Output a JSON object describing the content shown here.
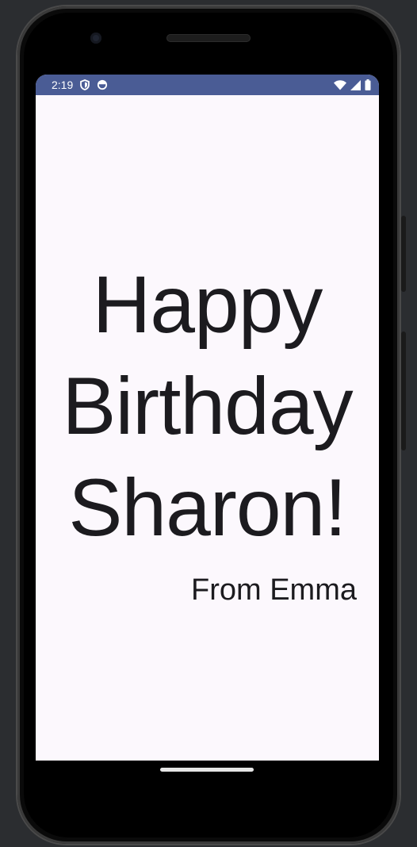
{
  "status_bar": {
    "time": "2:19",
    "left_icons": [
      "shield-icon",
      "data-saver-icon"
    ],
    "right_icons": [
      "wifi-icon",
      "cell-signal-icon",
      "battery-icon"
    ],
    "color": "#4a5c95"
  },
  "card": {
    "message": "Happy Birthday Sharon!",
    "signature": "From Emma",
    "background": "#fcf8fd",
    "text_color": "#1c1b1f"
  },
  "navigation": {
    "handle": "home-gesture-handle"
  }
}
